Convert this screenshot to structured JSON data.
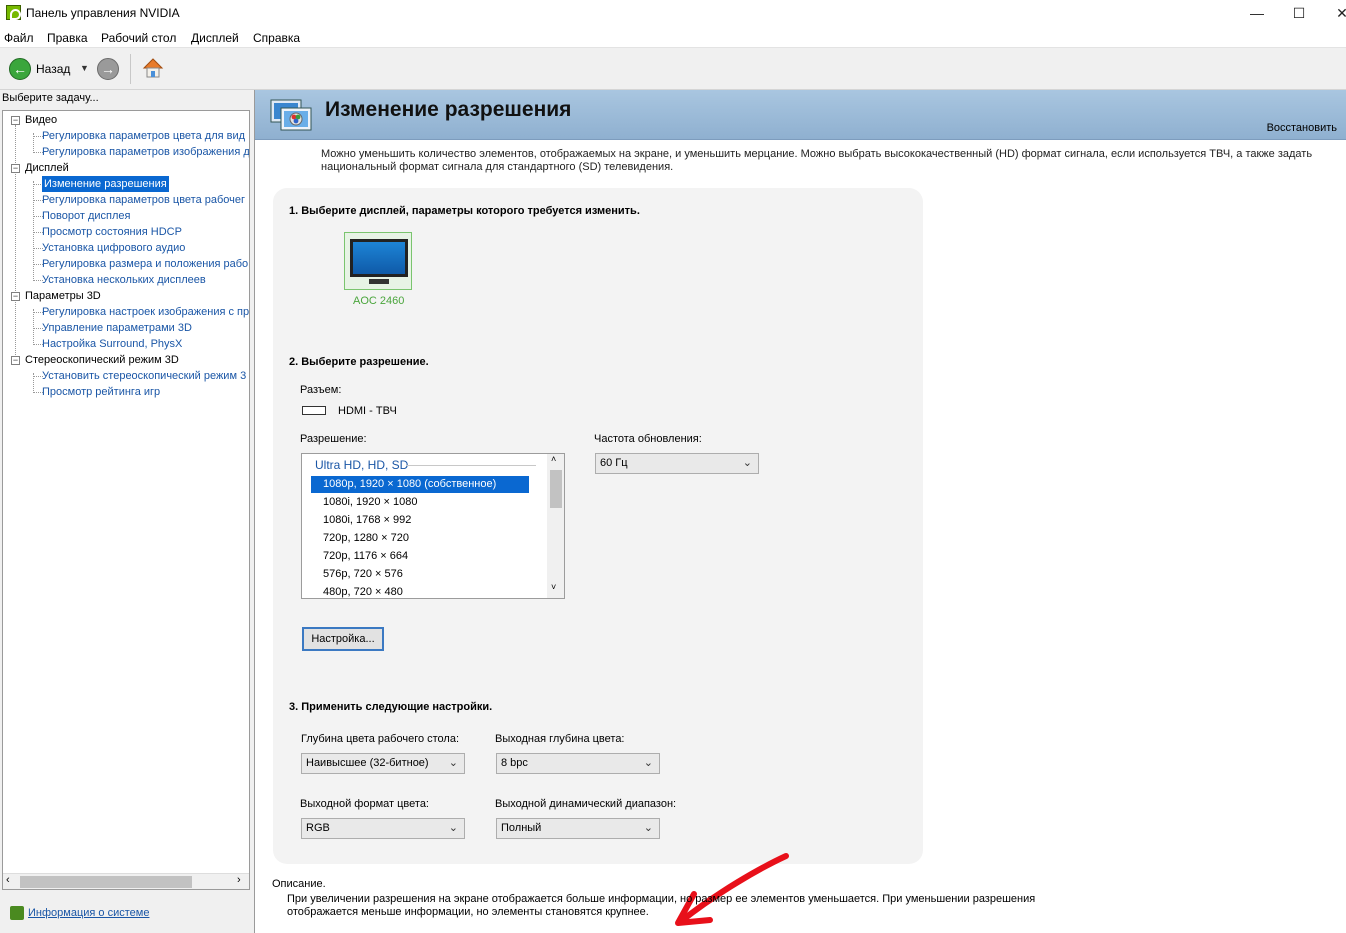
{
  "window": {
    "title": "Панель управления NVIDIA",
    "controls": {
      "minimize": "—",
      "maximize": "☐",
      "close": "✕"
    }
  },
  "menu": [
    "Файл",
    "Правка",
    "Рабочий стол",
    "Дисплей",
    "Справка"
  ],
  "toolbar": {
    "back_label": "Назад",
    "icons": [
      "back-arrow-icon",
      "dropdown-icon",
      "forward-arrow-icon",
      "home-icon"
    ]
  },
  "sidebar": {
    "header": "Выберите задачу...",
    "tree": [
      {
        "label": "Видео",
        "kind": "top"
      },
      {
        "label": "Регулировка параметров цвета для вид",
        "kind": "link"
      },
      {
        "label": "Регулировка параметров изображения д",
        "kind": "link"
      },
      {
        "label": "Дисплей",
        "kind": "top"
      },
      {
        "label": "Изменение разрешения",
        "kind": "selected"
      },
      {
        "label": "Регулировка параметров цвета рабочег",
        "kind": "link"
      },
      {
        "label": "Поворот дисплея",
        "kind": "link"
      },
      {
        "label": "Просмотр состояния HDCP",
        "kind": "link"
      },
      {
        "label": "Установка цифрового аудио",
        "kind": "link"
      },
      {
        "label": "Регулировка размера и положения рабо",
        "kind": "link"
      },
      {
        "label": "Установка нескольких дисплеев",
        "kind": "link"
      },
      {
        "label": "Параметры 3D",
        "kind": "top"
      },
      {
        "label": "Регулировка настроек изображения с пр",
        "kind": "link"
      },
      {
        "label": "Управление параметрами 3D",
        "kind": "link"
      },
      {
        "label": "Настройка Surround, PhysX",
        "kind": "link"
      },
      {
        "label": "Стереоскопический режим 3D",
        "kind": "top"
      },
      {
        "label": "Установить стереоскопический режим 3",
        "kind": "link"
      },
      {
        "label": "Просмотр рейтинга игр",
        "kind": "link"
      }
    ],
    "system_info_link": "Информация о системе"
  },
  "main": {
    "title": "Изменение разрешения",
    "restore_link": "Восстановить",
    "intro": "Можно уменьшить количество элементов, отображаемых на экране, и уменьшить мерцание. Можно выбрать высококачественный (HD) формат сигнала, если используется ТВЧ, а также задать национальный формат сигнала для стандартного (SD) телевидения.",
    "step1": {
      "title": "1. Выберите дисплей, параметры которого требуется изменить.",
      "display_name": "AOC 2460"
    },
    "step2": {
      "title": "2. Выберите разрешение.",
      "connector_label": "Разъем:",
      "connector_value": "HDMI - ТВЧ",
      "resolution_label": "Разрешение:",
      "resolution_group": "Ultra HD, HD, SD",
      "resolutions": [
        "1080p, 1920 × 1080 (собственное)",
        "1080i, 1920 × 1080",
        "1080i, 1768 × 992",
        "720p, 1280 × 720",
        "720p, 1176 × 664",
        "576p, 720 × 576",
        "480p, 720 × 480"
      ],
      "selected_index": 0,
      "refresh_label": "Частота обновления:",
      "refresh_value": "60 Гц",
      "setup_button": "Настройка..."
    },
    "step3": {
      "title": "3. Применить следующие настройки.",
      "desktop_depth_label": "Глубина цвета рабочего стола:",
      "desktop_depth_value": "Наивысшее (32-битное)",
      "output_depth_label": "Выходная глубина цвета:",
      "output_depth_value": "8 bpc",
      "color_format_label": "Выходной формат цвета:",
      "color_format_value": "RGB",
      "dynamic_range_label": "Выходной динамический диапазон:",
      "dynamic_range_value": "Полный"
    },
    "description": {
      "label": "Описание.",
      "text": "При увеличении разрешения на экране отображается больше информации, но размер ее элементов уменьшается. При уменьшении разрешения отображается меньше информации, но элементы становятся крупнее."
    }
  },
  "annotation": {
    "arrow_color": "#e8101a"
  }
}
